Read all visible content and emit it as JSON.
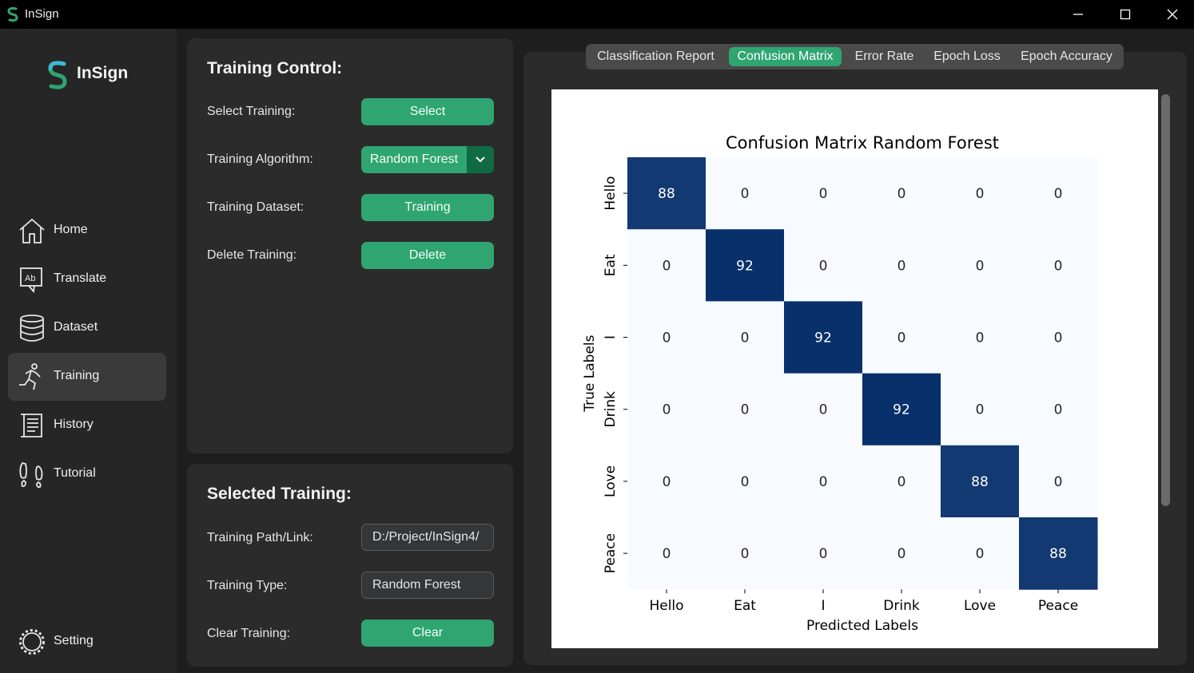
{
  "window": {
    "title": "InSign"
  },
  "sidebar": {
    "logo_text": "InSign",
    "items": [
      {
        "label": "Home",
        "icon": "home-icon"
      },
      {
        "label": "Translate",
        "icon": "translate-icon"
      },
      {
        "label": "Dataset",
        "icon": "database-icon"
      },
      {
        "label": "Training",
        "icon": "running-icon",
        "active": true
      },
      {
        "label": "History",
        "icon": "scroll-icon"
      },
      {
        "label": "Tutorial",
        "icon": "footprints-icon"
      }
    ],
    "setting_label": "Setting"
  },
  "training_control": {
    "title": "Training Control:",
    "select_label": "Select Training:",
    "select_button": "Select",
    "algorithm_label": "Training Algorithm:",
    "algorithm_value": "Random Forest",
    "dataset_label": "Training Dataset:",
    "dataset_button": "Training",
    "delete_label": "Delete Training:",
    "delete_button": "Delete"
  },
  "selected_training": {
    "title": "Selected Training:",
    "path_label": "Training Path/Link:",
    "path_value": "D:/Project/InSign4/",
    "type_label": "Training Type:",
    "type_value": "Random Forest",
    "clear_label": "Clear Training:",
    "clear_button": "Clear"
  },
  "tabs": [
    {
      "label": "Classification Report",
      "active": false
    },
    {
      "label": "Confusion Matrix",
      "active": true
    },
    {
      "label": "Error Rate",
      "active": false
    },
    {
      "label": "Epoch Loss",
      "active": false
    },
    {
      "label": "Epoch Accuracy",
      "active": false
    }
  ],
  "colors": {
    "accent": "#2fa572",
    "accent_dark": "#106a43",
    "heat_high": "#08306b",
    "heat_low": "#f7fbff"
  },
  "chart_data": {
    "type": "heatmap",
    "title": "Confusion Matrix Random Forest",
    "xlabel": "Predicted Labels",
    "ylabel": "True Labels",
    "x_categories": [
      "Hello",
      "Eat",
      "I",
      "Drink",
      "Love",
      "Peace"
    ],
    "y_categories": [
      "Hello",
      "Eat",
      "I",
      "Drink",
      "Love",
      "Peace"
    ],
    "values": [
      [
        88,
        0,
        0,
        0,
        0,
        0
      ],
      [
        0,
        92,
        0,
        0,
        0,
        0
      ],
      [
        0,
        0,
        92,
        0,
        0,
        0
      ],
      [
        0,
        0,
        0,
        92,
        0,
        0
      ],
      [
        0,
        0,
        0,
        0,
        88,
        0
      ],
      [
        0,
        0,
        0,
        0,
        0,
        88
      ]
    ],
    "colormap": "Blues",
    "annotate": true
  }
}
